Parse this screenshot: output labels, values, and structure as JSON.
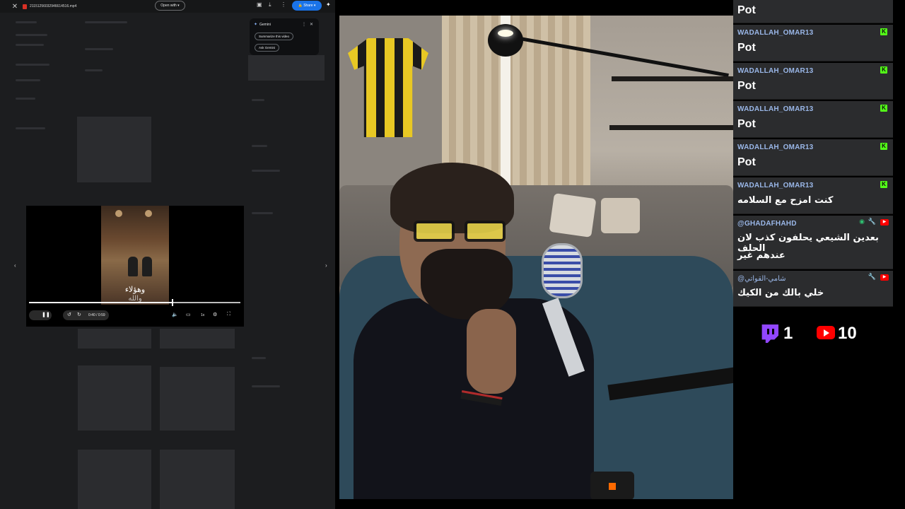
{
  "drive": {
    "file_name": "21151256032946614516.mp4",
    "open_with": "Open with",
    "share": "Share",
    "gemini": {
      "title": "Gemini",
      "chip_summarize": "Summarize this video",
      "chip_ask": "Ask Gemini"
    },
    "video": {
      "subtitle_line1": "وهؤلاء",
      "subtitle_line2": "والله",
      "time": "0:40 / 0:59",
      "speed": "1x",
      "progress": 0.68
    }
  },
  "chat": {
    "messages": [
      {
        "user": "",
        "text": "Pot",
        "badge": "none"
      },
      {
        "user": "WADALLAH_OMAR13",
        "text": "Pot",
        "badge": "kick"
      },
      {
        "user": "WADALLAH_OMAR13",
        "text": "Pot",
        "badge": "kick"
      },
      {
        "user": "WADALLAH_OMAR13",
        "text": "Pot",
        "badge": "kick"
      },
      {
        "user": "WADALLAH_OMAR13",
        "text": "Pot",
        "badge": "kick"
      },
      {
        "user": "WADALLAH_OMAR13",
        "text": "كنت امزح مع السلامه",
        "badge": "kick"
      },
      {
        "user": "@GHADAFHAHD",
        "text_line1": "بعدين الشيعي يحلفون كذب لان الحلف",
        "text_line2": "عندهم غير",
        "badge": "youtube"
      },
      {
        "user": "@شامي-القواتي",
        "text": "خلي بالك من الكيك",
        "badge": "youtube"
      }
    ]
  },
  "viewers": {
    "twitch": "1",
    "youtube": "10"
  },
  "colors": {
    "kick": "#53fc18",
    "youtube": "#ff0000",
    "twitch": "#9146ff",
    "chat_bg": "#2b2c2e",
    "username": "#9ab7e8",
    "share_blue": "#1a73e8"
  },
  "icons": [
    "close-icon",
    "download-icon",
    "more-icon",
    "gemini-spark-icon",
    "pause-icon",
    "volume-icon",
    "settings-icon",
    "fullscreen-icon",
    "kick-icon",
    "youtube-icon",
    "twitch-icon",
    "wrench-icon"
  ]
}
